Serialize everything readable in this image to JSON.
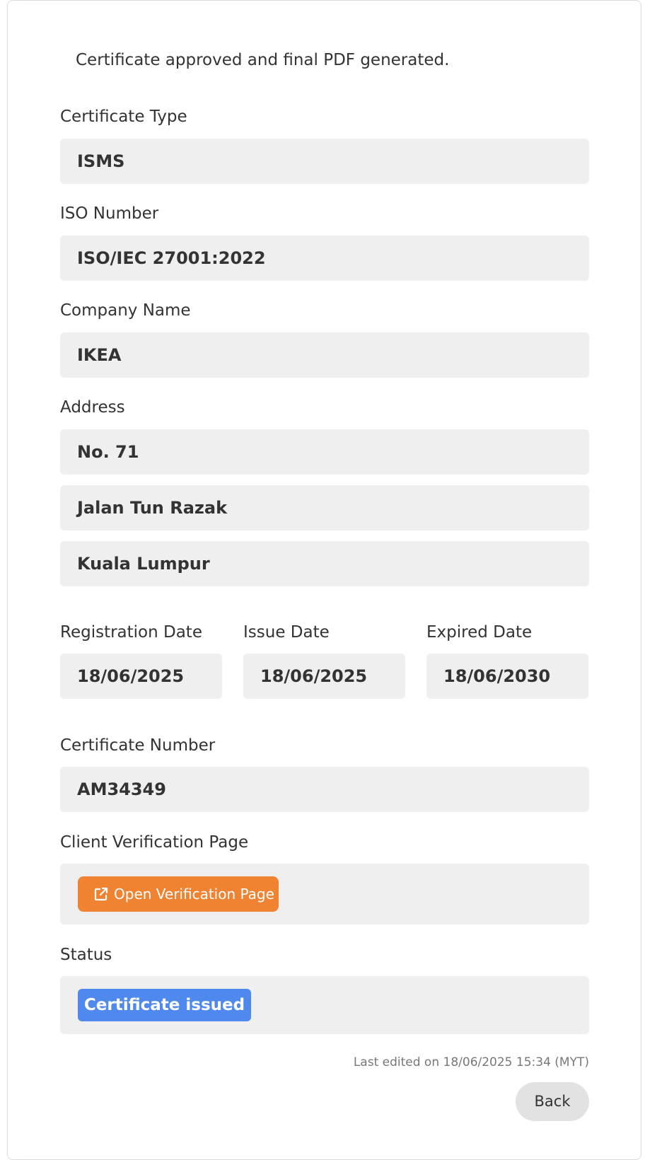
{
  "message": "Certificate approved and final PDF generated.",
  "certificate_type": {
    "label": "Certificate Type",
    "value": "ISMS"
  },
  "iso_number": {
    "label": "ISO Number",
    "value": "ISO/IEC 27001:2022"
  },
  "company_name": {
    "label": "Company Name",
    "value": "IKEA"
  },
  "address": {
    "label": "Address",
    "lines": [
      "No. 71",
      "Jalan Tun Razak",
      "Kuala Lumpur"
    ]
  },
  "dates": {
    "registration": {
      "label": "Registration Date",
      "value": "18/06/2025"
    },
    "issue": {
      "label": "Issue Date",
      "value": "18/06/2025"
    },
    "expired": {
      "label": "Expired Date",
      "value": "18/06/2030"
    }
  },
  "certificate_number": {
    "label": "Certificate Number",
    "value": "AM34349"
  },
  "verification": {
    "label": "Client Verification Page",
    "button_label": "Open Verification Page",
    "button_icon": "external-link-icon",
    "button_color": "#f08332"
  },
  "status": {
    "label": "Status",
    "badge": "Certificate issued",
    "badge_color": "#5089ee"
  },
  "last_edited": "Last edited on 18/06/2025 15:34 (MYT)",
  "back_label": "Back"
}
